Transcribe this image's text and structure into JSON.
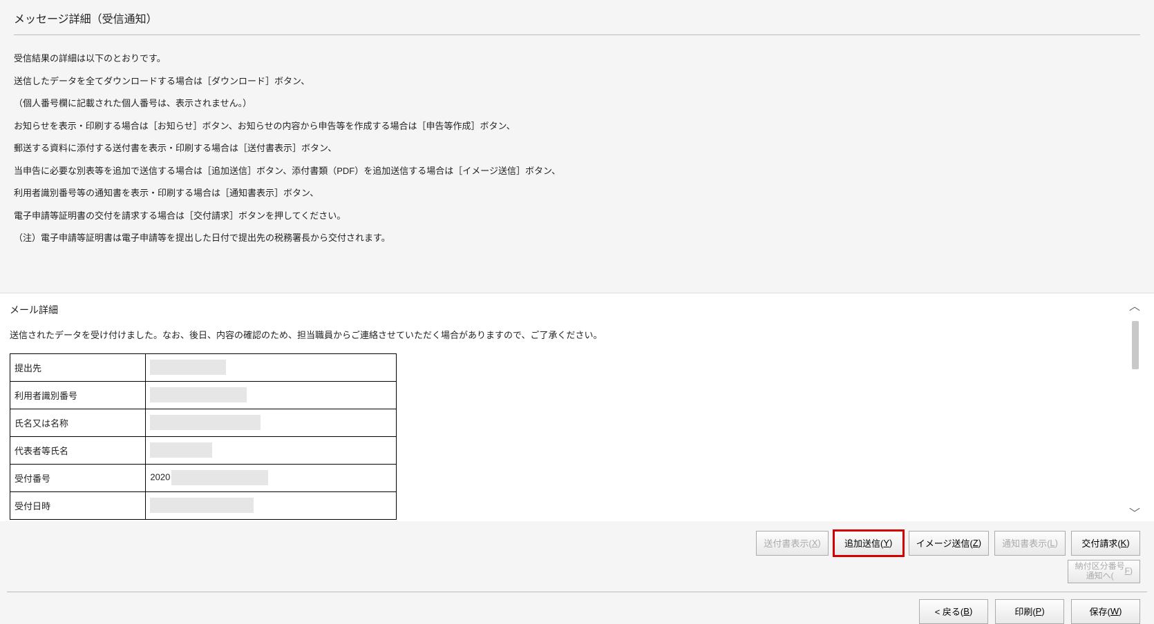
{
  "page_title": "メッセージ詳細（受信通知）",
  "instructions_lines": [
    "受信結果の詳細は以下のとおりです。",
    "送信したデータを全てダウンロードする場合は［ダウンロード］ボタン、",
    "（個人番号欄に記載された個人番号は、表示されません。）",
    "お知らせを表示・印刷する場合は［お知らせ］ボタン、お知らせの内容から申告等を作成する場合は［申告等作成］ボタン、",
    "郵送する資料に添付する送付書を表示・印刷する場合は［送付書表示］ボタン、",
    "当申告に必要な別表等を追加で送信する場合は［追加送信］ボタン、添付書類（PDF）を追加送信する場合は［イメージ送信］ボタン、",
    "利用者識別番号等の通知書を表示・印刷する場合は［通知書表示］ボタン、",
    "電子申請等証明書の交付を請求する場合は［交付請求］ボタンを押してください。",
    "（注）電子申請等証明書は電子申請等を提出した日付で提出先の税務署長から交付されます。"
  ],
  "mail_section_title": "メール詳細",
  "mail_intro": "送信されたデータを受け付けました。なお、後日、内容の確認のため、担当職員からご連絡させていただく場合がありますので、ご了承ください。",
  "table_rows": [
    {
      "label": "提出先",
      "value_visible_prefix": ""
    },
    {
      "label": "利用者識別番号",
      "value_visible_prefix": ""
    },
    {
      "label": "氏名又は名称",
      "value_visible_prefix": ""
    },
    {
      "label": "代表者等氏名",
      "value_visible_prefix": ""
    },
    {
      "label": "受付番号",
      "value_visible_prefix": "2020"
    },
    {
      "label": "受付日時",
      "value_visible_prefix": ""
    }
  ],
  "buttons_row1": {
    "transmittal_display": "送付書表示(X)",
    "additional_send": "追加送信(Y)",
    "image_send": "イメージ送信(Z)",
    "notice_display": "通知書表示(L)",
    "issue_request": "交付請求(K)"
  },
  "buttons_row2": {
    "payment_notice": "納付区分番号\n通知へ(F)"
  },
  "footer_buttons": {
    "back": "< 戻る(B)",
    "print": "印刷(P)",
    "save": "保存(W)"
  }
}
